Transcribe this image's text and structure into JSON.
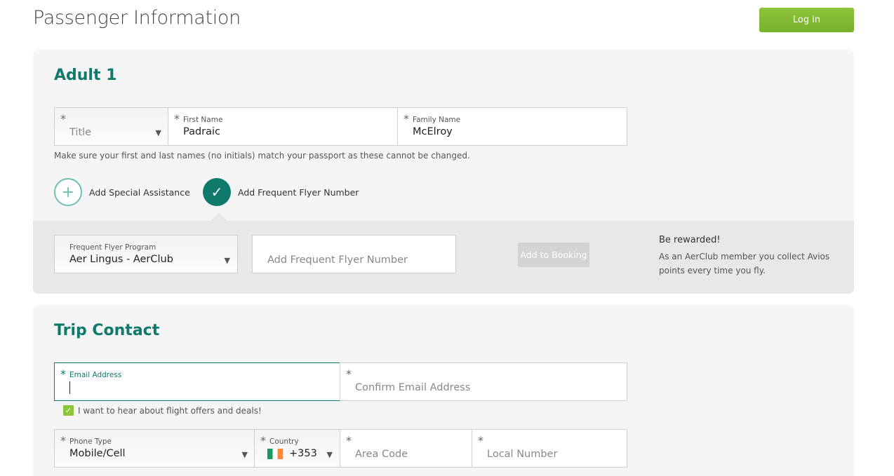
{
  "header": {
    "title": "Passenger Information",
    "login_label": "Log in"
  },
  "adult": {
    "heading": "Adult 1",
    "title_field": {
      "star": "*",
      "placeholder": "Title"
    },
    "first_name": {
      "star": "*",
      "label": "First Name",
      "value": "Padraic"
    },
    "family_name": {
      "star": "*",
      "label": "Family Name",
      "value": "McElroy"
    },
    "hint": "Make sure your first and last names (no initials) match your passport as these cannot be changed.",
    "special_assistance": {
      "icon": "plus-icon",
      "label": "Add Special Assistance"
    },
    "frequent_flyer_toggle": {
      "icon": "checkmark-icon",
      "label": "Add Frequent Flyer Number",
      "selected": true
    },
    "frequent_flyer": {
      "program_label": "Frequent Flyer Program",
      "program_value": "Aer Lingus - AerClub",
      "number_placeholder": "Add Frequent Flyer Number",
      "add_button": "Add to Booking",
      "rewarded_title": "Be rewarded!",
      "rewarded_text": "As an AerClub member you collect Avios points every time you fly."
    }
  },
  "trip_contact": {
    "heading": "Trip Contact",
    "email": {
      "star": "*",
      "label": "Email Address",
      "value": ""
    },
    "confirm_email": {
      "star": "*",
      "placeholder": "Confirm Email Address"
    },
    "offers_optin": {
      "label": "I want to hear about flight offers and deals!",
      "checked": true
    },
    "phone_type": {
      "star": "*",
      "label": "Phone Type",
      "value": "Mobile/Cell"
    },
    "country": {
      "star": "*",
      "label": "Country",
      "value": "+353",
      "flag": "ireland-flag-icon"
    },
    "area_code": {
      "star": "*",
      "placeholder": "Area Code"
    },
    "local_number": {
      "star": "*",
      "placeholder": "Local Number"
    }
  },
  "colors": {
    "accent": "#0f7a6c",
    "login_green": "#8cc43c",
    "panel_bg": "#f5f5f5",
    "band_bg": "#e8e8e8"
  }
}
